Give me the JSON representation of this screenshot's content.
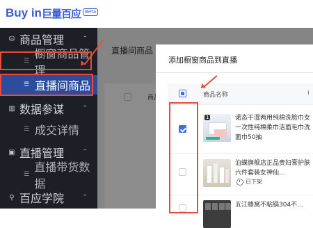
{
  "brand": {
    "logo_text": "Buy in",
    "logo_cn": "巨量百应",
    "beta": "Beta"
  },
  "colors": {
    "accent": "#3b6fe0",
    "sidebar_bg": "#1c1f26",
    "active_bg": "#2b4d9c",
    "highlight": "#e94a3b"
  },
  "sidebar": {
    "groups": [
      {
        "label": "商品管理",
        "icon": "product-icon",
        "expanded": true,
        "items": [
          {
            "label": "橱窗商品管理"
          },
          {
            "label": "直播间商品",
            "active": true
          }
        ]
      },
      {
        "label": "数据参谋",
        "icon": "chart-icon",
        "expanded": true,
        "items": [
          {
            "label": "成交详情"
          }
        ]
      },
      {
        "label": "直播管理",
        "icon": "video-icon",
        "expanded": true,
        "items": [
          {
            "label": "直播带货数据"
          }
        ]
      },
      {
        "label": "百应学院",
        "icon": "location-icon",
        "expanded": true,
        "items": []
      }
    ]
  },
  "main": {
    "title": "直播间商品",
    "col_header": "商品"
  },
  "modal": {
    "title": "添加橱窗商品到直播",
    "columns": {
      "name": "商品名称",
      "more": "i"
    },
    "rows": [
      {
        "name": "诺态干湿两用纯棉洗脸巾女一次性纯棉柔巾洁面毛巾洗面巾50抽",
        "badge": "1",
        "checked": true
      },
      {
        "name": "泊蝶旗舰店正品贵妇膏护肤六件套装女神仙…",
        "status": "已下架",
        "checked": false
      },
      {
        "name": "五江蜂窝不粘锅304不…",
        "checked": false
      }
    ]
  }
}
